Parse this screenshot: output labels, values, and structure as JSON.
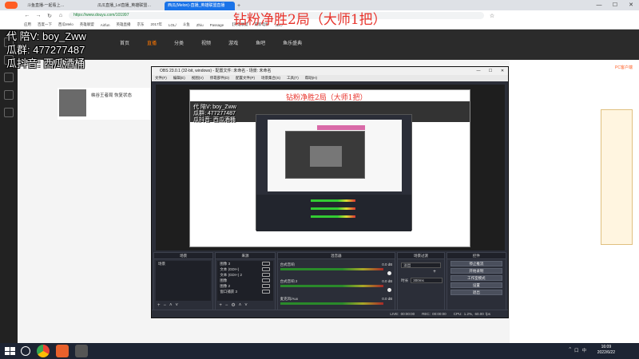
{
  "browser": {
    "tabs": [
      {
        "label": "斗鱼直播-一起看上…"
      },
      {
        "label": "瓜瓜直播_Lol直播_英雄联盟…"
      },
      {
        "label": "西瓜(Melon)-直播_英雄联盟直播"
      }
    ],
    "url": "https://www.douyu.com/101997",
    "bookmarks": [
      "应用",
      "百度一下",
      "西瓜Melo",
      "英雄联盟",
      "Airfun",
      "英雄直播",
      "京东",
      "2017年",
      "LOL/",
      "斗鱼",
      "Zhiu",
      "Passage",
      "【英雄联盟",
      "最新电影",
      "JDO"
    ],
    "win_controls": [
      "—",
      "☐",
      "✕"
    ]
  },
  "site": {
    "nav": [
      "首页",
      "直播",
      "分类",
      "视频",
      "游戏",
      "鱼吧",
      "鱼乐盛典"
    ],
    "streamer_name": "峡谷王者局 恢复状态",
    "right_panel_title": "PC客户端"
  },
  "overlay": {
    "title": "钻粉净胜2局（大师1把）",
    "line1": "代  陪V: boy_Zww",
    "line2": "瓜群: 477277487",
    "line3": "瓜抖音: 西瓜酒桶"
  },
  "obs": {
    "title": "OBS 23.0.1 (32-bit, windows) - 配置文件: 未命名 - 场景: 未命名",
    "menu": [
      "文件(F)",
      "编辑(E)",
      "视图(V)",
      "停靠部件(D)",
      "配置文件(P)",
      "场景集合(S)",
      "工具(T)",
      "帮助(H)"
    ],
    "nested": {
      "title": "钻粉净胜2局（大师1把）",
      "line1": "代  陪V: boy_Zww",
      "line2": "瓜群: 477277487",
      "line3": "瓜抖音: 西瓜酒桶"
    },
    "docks": {
      "scenes": {
        "header": "场景",
        "items": [
          "场景"
        ]
      },
      "sources": {
        "header": "来源",
        "items": [
          "图像 3",
          "文本 (GDI+)",
          "文本 (GDI+) 2",
          "图像",
          "图像 2",
          "窗口捕获 3"
        ]
      },
      "mixer": {
        "header": "混音器",
        "channels": [
          {
            "name": "台式音响",
            "db": "0.0 dB"
          },
          {
            "name": "台式音响 2",
            "db": "0.0 dB"
          },
          {
            "name": "麦克风/Aux",
            "db": "0.0 dB"
          }
        ]
      },
      "transitions": {
        "header": "场景过渡",
        "type": "淡出",
        "duration_label": "时长",
        "duration": "300ms"
      },
      "controls": {
        "header": "控件",
        "buttons": [
          "停止推流",
          "开始录制",
          "工作室模式",
          "设置",
          "退出"
        ]
      }
    },
    "status": {
      "live": "LIVE: 00:00:00",
      "rec": "REC: 00:00:00",
      "cpu": "CPU: 1.2%, 60.00 fps"
    }
  },
  "taskbar": {
    "time": "16:09",
    "date": "2022/6/22",
    "tray": [
      "^",
      "口",
      "中"
    ]
  }
}
